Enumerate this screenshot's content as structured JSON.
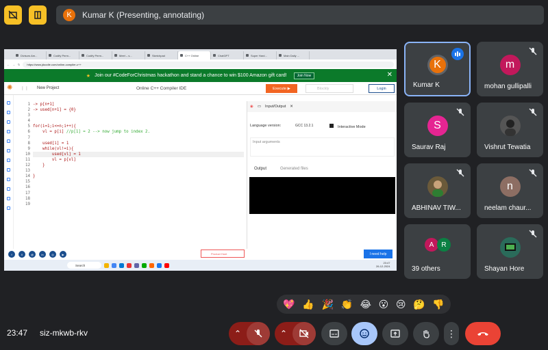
{
  "presenter": {
    "initial": "K",
    "label": "Kumar K (Presenting, annotating)"
  },
  "browser": {
    "tabs": [
      "Divisors Am...",
      "Codify Perm...",
      "Codify Perm...",
      "Meet – s...",
      "Sketchpad",
      "C++ Online",
      "ChatGPT",
      "Super Hard...",
      "Main Daily ..."
    ],
    "url": "https://www.jdoodle.com/online-compiler-c++"
  },
  "banner": {
    "text": "Join our #CodeForChristmas hackathon and stand a chance to win $100 Amazon gift card!",
    "button": "Join Now"
  },
  "ide": {
    "new_project": "New Project",
    "title": "Online C++ Compiler IDE",
    "execute": "Execute ▶",
    "blockly": "Blockly",
    "login": "Login",
    "io_tab": "Input/Output",
    "language_label": "Language version:",
    "gcc": "GCC 13.2.1",
    "interactive": "Interactive Mode",
    "input_placeholder": "Input arguments",
    "output_tab": "Output",
    "generated_tab": "Generated files",
    "product_hunt": "Product Hunt",
    "help": "I need help"
  },
  "code_lines": [
    "1",
    "2",
    "3",
    "4",
    "5",
    "6",
    "7",
    "8",
    "9",
    "10",
    "11",
    "12",
    "13",
    "14",
    "15",
    "16",
    "17",
    "18",
    "19"
  ],
  "taskbar": {
    "search": "Search",
    "time": "23:47",
    "date": "26-12-2024",
    "lang": "ENG IN"
  },
  "participants": [
    {
      "name": "Kumar K",
      "initial": "K",
      "color": "#e8710a",
      "speaking": true
    },
    {
      "name": "mohan gullipalli",
      "initial": "m",
      "color": "#c2185b"
    },
    {
      "name": "Saurav Raj",
      "initial": "S",
      "color": "#e52592"
    },
    {
      "name": "Vishrut Tewatia",
      "initial": "",
      "color": "#555"
    },
    {
      "name": "ABHINAV TIW...",
      "initial": "",
      "color": "#6b5a3a"
    },
    {
      "name": "neelam chaur...",
      "initial": "n",
      "color": "#8d6e63"
    },
    {
      "name": "39 others",
      "initial": "",
      "color": ""
    },
    {
      "name": "Shayan Hore",
      "initial": "",
      "color": "#2a6b5a"
    }
  ],
  "others_avatars": [
    {
      "initial": "A",
      "color": "#c2185b"
    },
    {
      "initial": "R",
      "color": "#0b8043"
    }
  ],
  "emojis": [
    "💖",
    "👍",
    "🎉",
    "👏",
    "😂",
    "😮",
    "😢",
    "🤔",
    "👎"
  ],
  "bottom": {
    "time": "23:47",
    "meeting_code": "siz-mkwb-rkv"
  }
}
